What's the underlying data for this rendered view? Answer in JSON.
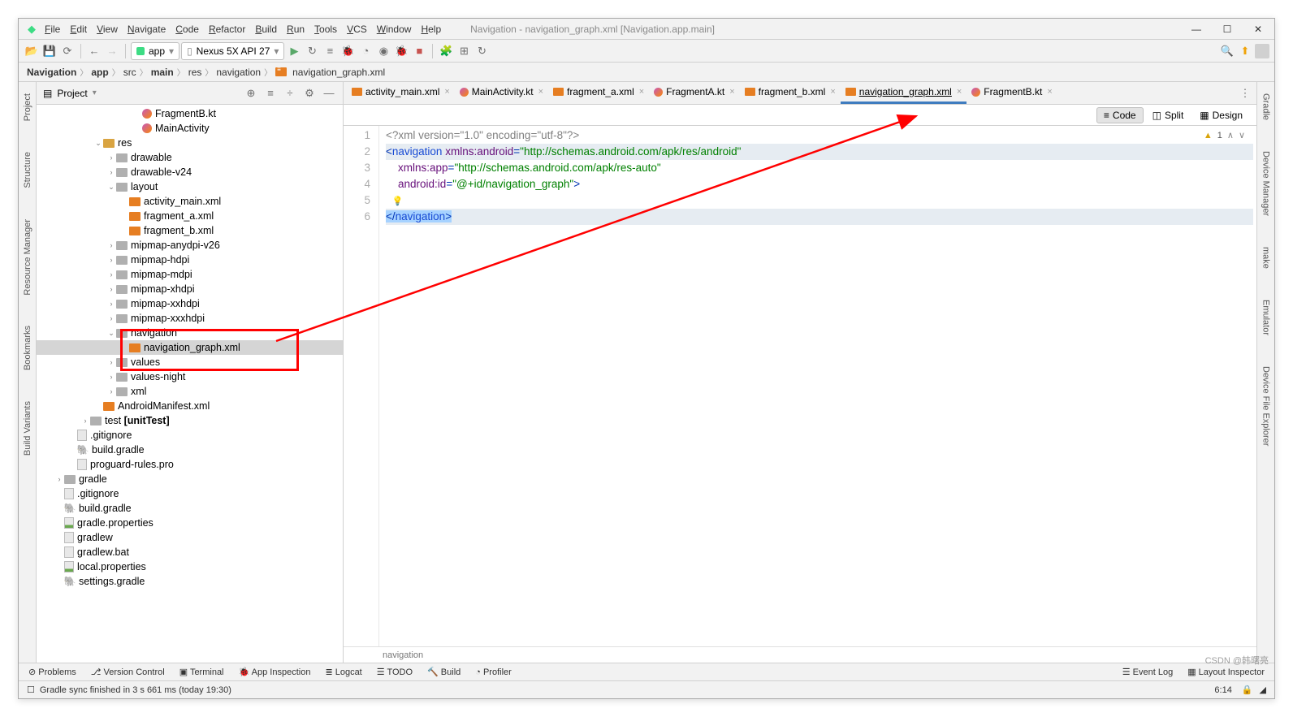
{
  "window_title": "Navigation - navigation_graph.xml [Navigation.app.main]",
  "menus": [
    "File",
    "Edit",
    "View",
    "Navigate",
    "Code",
    "Refactor",
    "Build",
    "Run",
    "Tools",
    "VCS",
    "Window",
    "Help"
  ],
  "combo_app": "app",
  "combo_device": "Nexus 5X API 27",
  "breadcrumb": [
    "Navigation",
    "app",
    "src",
    "main",
    "res",
    "navigation",
    "navigation_graph.xml"
  ],
  "proj_label": "Project",
  "left_rail": [
    "Project",
    "Structure",
    "Resource Manager",
    "Bookmarks",
    "Build Variants"
  ],
  "right_rail": [
    "Gradle",
    "Device Manager",
    "make",
    "Emulator",
    "Device File Explorer"
  ],
  "tree": [
    {
      "d": 7,
      "a": "",
      "i": "kt",
      "t": "FragmentB.kt"
    },
    {
      "d": 7,
      "a": "",
      "i": "kt",
      "t": "MainActivity"
    },
    {
      "d": 4,
      "a": "v",
      "i": "res",
      "t": "res"
    },
    {
      "d": 5,
      "a": ">",
      "i": "folder",
      "t": "drawable"
    },
    {
      "d": 5,
      "a": ">",
      "i": "folder",
      "t": "drawable-v24"
    },
    {
      "d": 5,
      "a": "v",
      "i": "folder",
      "t": "layout"
    },
    {
      "d": 6,
      "a": "",
      "i": "xml",
      "t": "activity_main.xml"
    },
    {
      "d": 6,
      "a": "",
      "i": "xml",
      "t": "fragment_a.xml"
    },
    {
      "d": 6,
      "a": "",
      "i": "xml",
      "t": "fragment_b.xml"
    },
    {
      "d": 5,
      "a": ">",
      "i": "folder",
      "t": "mipmap-anydpi-v26"
    },
    {
      "d": 5,
      "a": ">",
      "i": "folder",
      "t": "mipmap-hdpi"
    },
    {
      "d": 5,
      "a": ">",
      "i": "folder",
      "t": "mipmap-mdpi"
    },
    {
      "d": 5,
      "a": ">",
      "i": "folder",
      "t": "mipmap-xhdpi"
    },
    {
      "d": 5,
      "a": ">",
      "i": "folder",
      "t": "mipmap-xxhdpi"
    },
    {
      "d": 5,
      "a": ">",
      "i": "folder",
      "t": "mipmap-xxxhdpi"
    },
    {
      "d": 5,
      "a": "v",
      "i": "folder",
      "t": "navigation"
    },
    {
      "d": 6,
      "a": "",
      "i": "xml",
      "t": "navigation_graph.xml",
      "sel": true
    },
    {
      "d": 5,
      "a": ">",
      "i": "folder",
      "t": "values"
    },
    {
      "d": 5,
      "a": ">",
      "i": "folder",
      "t": "values-night"
    },
    {
      "d": 5,
      "a": ">",
      "i": "folder",
      "t": "xml"
    },
    {
      "d": 4,
      "a": "",
      "i": "xml",
      "t": "AndroidManifest.xml"
    },
    {
      "d": 3,
      "a": ">",
      "i": "folder",
      "t": "test [unitTest]",
      "bold": "[unitTest]"
    },
    {
      "d": 2,
      "a": "",
      "i": "txt",
      "t": ".gitignore"
    },
    {
      "d": 2,
      "a": "",
      "i": "gradle",
      "t": "build.gradle"
    },
    {
      "d": 2,
      "a": "",
      "i": "txt",
      "t": "proguard-rules.pro"
    },
    {
      "d": 1,
      "a": ">",
      "i": "folder",
      "t": "gradle"
    },
    {
      "d": 1,
      "a": "",
      "i": "txt",
      "t": ".gitignore"
    },
    {
      "d": 1,
      "a": "",
      "i": "gradle",
      "t": "build.gradle"
    },
    {
      "d": 1,
      "a": "",
      "i": "prop",
      "t": "gradle.properties"
    },
    {
      "d": 1,
      "a": "",
      "i": "txt",
      "t": "gradlew"
    },
    {
      "d": 1,
      "a": "",
      "i": "txt",
      "t": "gradlew.bat"
    },
    {
      "d": 1,
      "a": "",
      "i": "prop",
      "t": "local.properties"
    },
    {
      "d": 1,
      "a": "",
      "i": "gradle",
      "t": "settings.gradle"
    }
  ],
  "tabs": [
    {
      "icon": "xml",
      "label": "activity_main.xml"
    },
    {
      "icon": "kt",
      "label": "MainActivity.kt"
    },
    {
      "icon": "xml",
      "label": "fragment_a.xml"
    },
    {
      "icon": "kt",
      "label": "FragmentA.kt"
    },
    {
      "icon": "xml",
      "label": "fragment_b.xml"
    },
    {
      "icon": "xml",
      "label": "navigation_graph.xml",
      "active": true
    },
    {
      "icon": "kt",
      "label": "FragmentB.kt"
    }
  ],
  "view_modes": {
    "code": "Code",
    "split": "Split",
    "design": "Design"
  },
  "warn_count": "1",
  "code_lines": [
    "1",
    "2",
    "3",
    "4",
    "5",
    "6"
  ],
  "crumb_bottom": "navigation",
  "bottom_tools": [
    "Problems",
    "Version Control",
    "Terminal",
    "App Inspection",
    "Logcat",
    "TODO",
    "Build",
    "Profiler"
  ],
  "bottom_right": [
    "Event Log",
    "Layout Inspector"
  ],
  "status": "Gradle sync finished in 3 s 661 ms (today 19:30)",
  "cursor": "6:14",
  "watermark": "CSDN @韩曙亮",
  "xml": {
    "decl": "<?xml version=\"1.0\" encoding=\"utf-8\"?>",
    "nav_open": "navigation",
    "xmlns_android_k": "xmlns:android",
    "xmlns_android_v": "\"http://schemas.android.com/apk/res/android\"",
    "xmlns_app_k": "xmlns:app",
    "xmlns_app_v": "\"http://schemas.android.com/apk/res-auto\"",
    "android_id_k": "android:id",
    "android_id_v": "\"@+id/navigation_graph\"",
    "nav_close": "navigation"
  }
}
